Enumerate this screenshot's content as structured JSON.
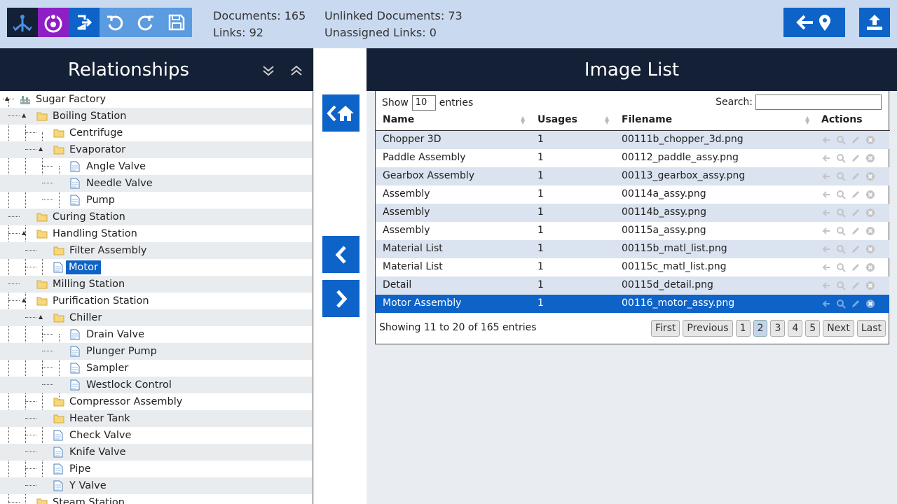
{
  "toolbar": {
    "icons": [
      "relationships-icon",
      "user-ring-icon",
      "logout-icon",
      "undo-icon",
      "redo-icon",
      "save-icon",
      "back-location-icon",
      "upload-icon"
    ],
    "colors": {
      "dark": "#142035",
      "purple": "#8e1fc4",
      "blue": "#0d63c8",
      "light_blue": "#5b9bdf",
      "bar": "#c9daf0"
    }
  },
  "stats": {
    "documents": "Documents: 165",
    "links": "Links: 92",
    "unlinked": "Unlinked Documents: 73",
    "unassigned": "Unassigned Links: 0"
  },
  "relationships": {
    "title": "Relationships",
    "tree": [
      {
        "label": "Sugar Factory",
        "type": "root",
        "depth": 0
      },
      {
        "label": "Boiling Station",
        "type": "folder",
        "depth": 1
      },
      {
        "label": "Centrifuge",
        "type": "folder",
        "depth": 2
      },
      {
        "label": "Evaporator",
        "type": "folder",
        "depth": 2
      },
      {
        "label": "Angle Valve",
        "type": "doc",
        "depth": 3
      },
      {
        "label": "Needle Valve",
        "type": "doc",
        "depth": 3
      },
      {
        "label": "Pump",
        "type": "doc",
        "depth": 3
      },
      {
        "label": "Curing Station",
        "type": "folder",
        "depth": 1
      },
      {
        "label": "Handling Station",
        "type": "folder",
        "depth": 1
      },
      {
        "label": "Filter Assembly",
        "type": "folder",
        "depth": 2
      },
      {
        "label": "Motor",
        "type": "doc",
        "depth": 2,
        "selected": true
      },
      {
        "label": "Milling Station",
        "type": "folder",
        "depth": 1
      },
      {
        "label": "Purification Station",
        "type": "folder",
        "depth": 1
      },
      {
        "label": "Chiller",
        "type": "folder",
        "depth": 2
      },
      {
        "label": "Drain Valve",
        "type": "doc",
        "depth": 3
      },
      {
        "label": "Plunger Pump",
        "type": "doc",
        "depth": 3
      },
      {
        "label": "Sampler",
        "type": "doc",
        "depth": 3
      },
      {
        "label": "Westlock Control",
        "type": "doc",
        "depth": 3
      },
      {
        "label": "Compressor Assembly",
        "type": "folder",
        "depth": 2
      },
      {
        "label": "Heater Tank",
        "type": "folder",
        "depth": 2
      },
      {
        "label": "Check Valve",
        "type": "doc",
        "depth": 2
      },
      {
        "label": "Knife Valve",
        "type": "doc",
        "depth": 2
      },
      {
        "label": "Pipe",
        "type": "doc",
        "depth": 2
      },
      {
        "label": "Y Valve",
        "type": "doc",
        "depth": 2
      },
      {
        "label": "Steam Station",
        "type": "folder",
        "depth": 1
      }
    ]
  },
  "image_list": {
    "title": "Image List",
    "show_label": "Show",
    "show_value": "10",
    "entries_label": "entries",
    "search_label": "Search:",
    "columns": [
      "Name",
      "Usages",
      "Filename",
      "Actions"
    ],
    "rows": [
      {
        "name": "Chopper 3D",
        "usages": "1",
        "filename": "00111b_chopper_3d.png"
      },
      {
        "name": "Paddle Assembly",
        "usages": "1",
        "filename": "00112_paddle_assy.png"
      },
      {
        "name": "Gearbox Assembly",
        "usages": "1",
        "filename": "00113_gearbox_assy.png"
      },
      {
        "name": "Assembly",
        "usages": "1",
        "filename": "00114a_assy.png"
      },
      {
        "name": "Assembly",
        "usages": "1",
        "filename": "00114b_assy.png"
      },
      {
        "name": "Assembly",
        "usages": "1",
        "filename": "00115a_assy.png"
      },
      {
        "name": "Material List",
        "usages": "1",
        "filename": "00115b_matl_list.png"
      },
      {
        "name": "Material List",
        "usages": "1",
        "filename": "00115c_matl_list.png"
      },
      {
        "name": "Detail",
        "usages": "1",
        "filename": "00115d_detail.png"
      },
      {
        "name": "Motor Assembly",
        "usages": "1",
        "filename": "00116_motor_assy.png",
        "active": true
      }
    ],
    "info": "Showing 11 to 20 of 165 entries",
    "pager": [
      "First",
      "Previous",
      "1",
      "2",
      "3",
      "4",
      "5",
      "Next",
      "Last"
    ],
    "current_page": "2"
  }
}
